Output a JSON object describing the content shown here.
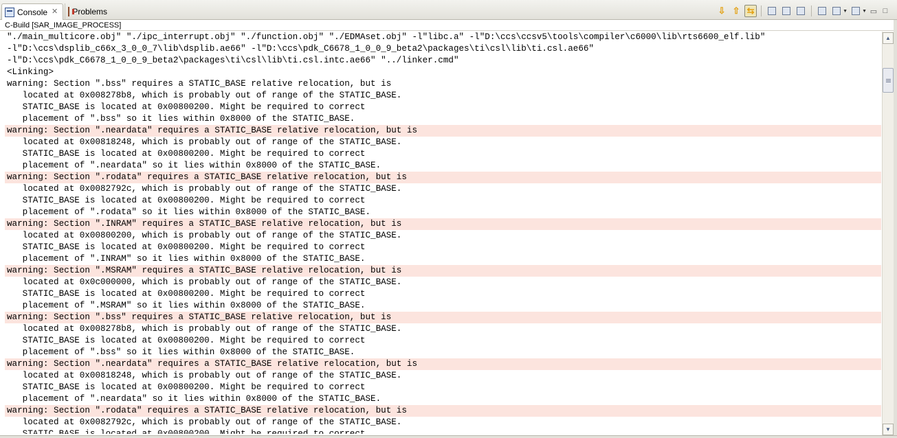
{
  "tabs": [
    {
      "label": "Console",
      "icon": "console-icon",
      "active": true
    },
    {
      "label": "Problems",
      "icon": "problems-icon",
      "active": false
    }
  ],
  "toolbar": {
    "icons": [
      "scroll-down-icon",
      "scroll-up-icon",
      "scroll-lock-icon",
      "clear-console-icon",
      "pin-console-icon",
      "show-console-icon",
      "open-console-icon",
      "display-selected-console-icon",
      "new-console-icon",
      "minimize-icon",
      "maximize-icon"
    ]
  },
  "console": {
    "title": "C-Build [SAR_IMAGE_PROCESS]",
    "lines": [
      {
        "text": "\"./main_multicore.obj\" \"./ipc_interrupt.obj\" \"./function.obj\" \"./EDMAset.obj\" -l\"libc.a\" -l\"D:\\ccs\\ccsv5\\tools\\compiler\\c6000\\lib\\rts6600_elf.lib\"",
        "warn": false
      },
      {
        "text": "-l\"D:\\ccs\\dsplib_c66x_3_0_0_7\\lib\\dsplib.ae66\" -l\"D:\\ccs\\pdk_C6678_1_0_0_9_beta2\\packages\\ti\\csl\\lib\\ti.csl.ae66\"",
        "warn": false
      },
      {
        "text": "-l\"D:\\ccs\\pdk_C6678_1_0_0_9_beta2\\packages\\ti\\csl\\lib\\ti.csl.intc.ae66\" \"../linker.cmd\"",
        "warn": false
      },
      {
        "text": "<Linking>",
        "warn": false
      },
      {
        "text": "warning: Section \".bss\" requires a STATIC_BASE relative relocation, but is",
        "warn": false
      },
      {
        "text": "   located at 0x008278b8, which is probably out of range of the STATIC_BASE.",
        "warn": false
      },
      {
        "text": "   STATIC_BASE is located at 0x00800200. Might be required to correct",
        "warn": false
      },
      {
        "text": "   placement of \".bss\" so it lies within 0x8000 of the STATIC_BASE.",
        "warn": false
      },
      {
        "text": "warning: Section \".neardata\" requires a STATIC_BASE relative relocation, but is",
        "warn": true
      },
      {
        "text": "   located at 0x00818248, which is probably out of range of the STATIC_BASE.",
        "warn": false
      },
      {
        "text": "   STATIC_BASE is located at 0x00800200. Might be required to correct",
        "warn": false
      },
      {
        "text": "   placement of \".neardata\" so it lies within 0x8000 of the STATIC_BASE.",
        "warn": false
      },
      {
        "text": "warning: Section \".rodata\" requires a STATIC_BASE relative relocation, but is",
        "warn": true
      },
      {
        "text": "   located at 0x0082792c, which is probably out of range of the STATIC_BASE.",
        "warn": false
      },
      {
        "text": "   STATIC_BASE is located at 0x00800200. Might be required to correct",
        "warn": false
      },
      {
        "text": "   placement of \".rodata\" so it lies within 0x8000 of the STATIC_BASE.",
        "warn": false
      },
      {
        "text": "warning: Section \".INRAM\" requires a STATIC_BASE relative relocation, but is",
        "warn": true
      },
      {
        "text": "   located at 0x00800200, which is probably out of range of the STATIC_BASE.",
        "warn": false
      },
      {
        "text": "   STATIC_BASE is located at 0x00800200. Might be required to correct",
        "warn": false
      },
      {
        "text": "   placement of \".INRAM\" so it lies within 0x8000 of the STATIC_BASE.",
        "warn": false
      },
      {
        "text": "warning: Section \".MSRAM\" requires a STATIC_BASE relative relocation, but is",
        "warn": true
      },
      {
        "text": "   located at 0x0c000000, which is probably out of range of the STATIC_BASE.",
        "warn": false
      },
      {
        "text": "   STATIC_BASE is located at 0x00800200. Might be required to correct",
        "warn": false
      },
      {
        "text": "   placement of \".MSRAM\" so it lies within 0x8000 of the STATIC_BASE.",
        "warn": false
      },
      {
        "text": "warning: Section \".bss\" requires a STATIC_BASE relative relocation, but is",
        "warn": true
      },
      {
        "text": "   located at 0x008278b8, which is probably out of range of the STATIC_BASE.",
        "warn": false
      },
      {
        "text": "   STATIC_BASE is located at 0x00800200. Might be required to correct",
        "warn": false
      },
      {
        "text": "   placement of \".bss\" so it lies within 0x8000 of the STATIC_BASE.",
        "warn": false
      },
      {
        "text": "warning: Section \".neardata\" requires a STATIC_BASE relative relocation, but is",
        "warn": true
      },
      {
        "text": "   located at 0x00818248, which is probably out of range of the STATIC_BASE.",
        "warn": false
      },
      {
        "text": "   STATIC_BASE is located at 0x00800200. Might be required to correct",
        "warn": false
      },
      {
        "text": "   placement of \".neardata\" so it lies within 0x8000 of the STATIC_BASE.",
        "warn": false
      },
      {
        "text": "warning: Section \".rodata\" requires a STATIC_BASE relative relocation, but is",
        "warn": true
      },
      {
        "text": "   located at 0x0082792c, which is probably out of range of the STATIC_BASE.",
        "warn": false
      },
      {
        "text": "   STATIC_BASE is located at 0x00800200. Might be required to correct",
        "warn": false
      }
    ],
    "warning_highlight_color": "#fce4de"
  },
  "scrollbar": {
    "position": 0.07
  }
}
